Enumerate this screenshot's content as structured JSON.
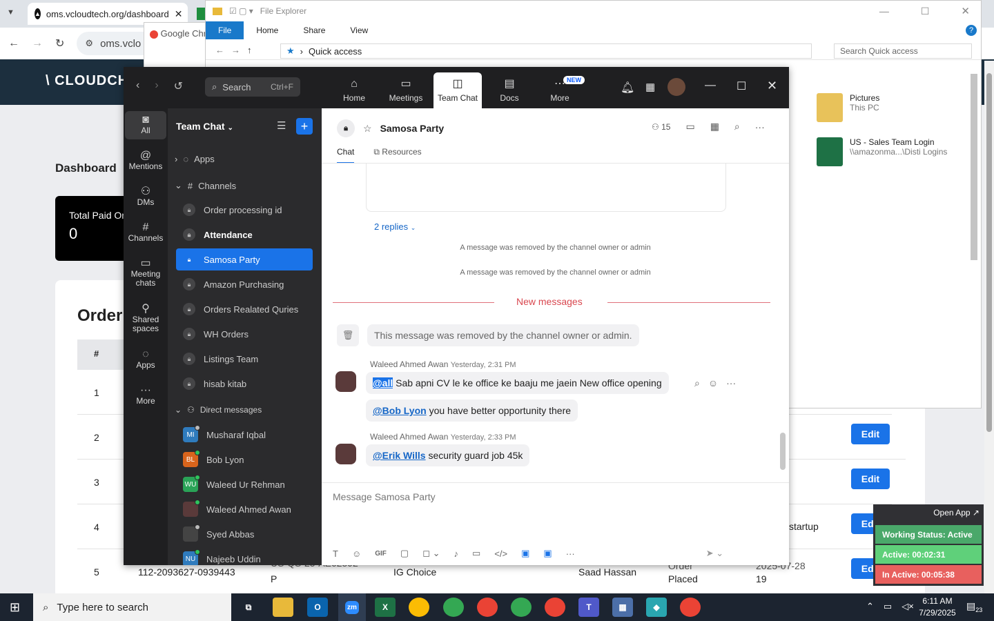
{
  "chrome": {
    "tab_title": "oms.vcloudtech.org/dashboard",
    "url": "oms.vclo",
    "popup_title": "Google Chr"
  },
  "site": {
    "logo": "\\ CLOUDCH",
    "dashboard_title": "Dashboard",
    "paid_card_label": "Total Paid Or",
    "paid_card_value": "0",
    "orders_title": "Order",
    "orders_header_num": "#",
    "row_numbers": [
      "1",
      "2",
      "3",
      "4",
      "5"
    ],
    "edit_label": "Edit",
    "row5": {
      "order_id": "112-2093627-0939443",
      "sku": "US-QS-25-AE62592",
      "sku_suffix": "P",
      "company": "IG Choice",
      "agent": "Saad Hassan",
      "status": "Order",
      "status2": "Placed",
      "date": "2025-07-28",
      "date2": "19"
    },
    "row4_note": "startup"
  },
  "explorer": {
    "title": "File Explorer",
    "ribbon": [
      "File",
      "Home",
      "Share",
      "View"
    ],
    "path": "Quick access",
    "search_placeholder": "Search Quick access",
    "items": [
      {
        "name": "Pictures",
        "sub": "This PC"
      },
      {
        "name": "US - Sales Team Login",
        "sub": "\\\\amazonma...\\Disti Logins"
      }
    ]
  },
  "zoom": {
    "search_label": "Search",
    "search_shortcut": "Ctrl+F",
    "tabs": [
      {
        "label": "Home",
        "icon": "⌂"
      },
      {
        "label": "Meetings",
        "icon": "▭"
      },
      {
        "label": "Team Chat",
        "icon": "◫"
      },
      {
        "label": "Docs",
        "icon": "▤"
      },
      {
        "label": "More",
        "icon": "⋯"
      }
    ],
    "new_badge": "NEW",
    "rail": [
      {
        "label": "All",
        "icon": "◙"
      },
      {
        "label": "Mentions",
        "icon": "@"
      },
      {
        "label": "DMs",
        "icon": "⚇"
      },
      {
        "label": "Channels",
        "icon": "#"
      },
      {
        "label": "Meeting chats",
        "icon": "▭"
      },
      {
        "label": "Shared spaces",
        "icon": "⚲"
      },
      {
        "label": "Apps",
        "icon": "◌"
      },
      {
        "label": "More",
        "icon": "···"
      }
    ],
    "sidebar": {
      "title": "Team Chat",
      "apps_label": "Apps",
      "channels_label": "Channels",
      "channels": [
        "Order processing id",
        "Attendance",
        "Samosa Party",
        "Amazon Purchasing",
        "Orders Realated Quries",
        "WH Orders",
        "Listings Team",
        "hisab kitab"
      ],
      "dm_label": "Direct messages",
      "dms": [
        {
          "name": "Musharaf Iqbal",
          "initials": "MI",
          "color": "#2f7bbd"
        },
        {
          "name": "Bob Lyon",
          "initials": "BL",
          "color": "#d8641c"
        },
        {
          "name": "Waleed Ur Rehman",
          "initials": "WU",
          "color": "#2aa357"
        },
        {
          "name": "Waleed Ahmed Awan",
          "initials": "",
          "color": "#5a3a3a"
        },
        {
          "name": "Syed Abbas",
          "initials": "",
          "color": "#444444"
        },
        {
          "name": "Najeeb Uddin",
          "initials": "NU",
          "color": "#2f7bbd"
        }
      ]
    },
    "channel": {
      "name": "Samosa Party",
      "member_count": "15",
      "tabs": [
        "Chat",
        "Resources"
      ],
      "replies": "2 replies",
      "removed_small": "A message was removed by the channel owner or admin",
      "new_messages": "New messages",
      "removed_big": "This message was removed by the channel owner or admin.",
      "msg1_sender": "Waleed Ahmed Awan",
      "msg1_time": "Yesterday, 2:31 PM",
      "msg1_mention": "@all",
      "msg1_text": " Sab apni CV le ke office ke baaju me jaein New office opening",
      "msg2_mention": "@Bob Lyon",
      "msg2_text": " you have better opportunity there",
      "msg3_sender": "Waleed Ahmed Awan",
      "msg3_time": "Yesterday, 2:33 PM",
      "msg3_mention": "@Erik Wills",
      "msg3_text": " security guard job 45k",
      "composer_placeholder": "Message Samosa Party"
    }
  },
  "status_widget": {
    "open_app": "Open App ↗",
    "working": "Working Status: Active",
    "active": "Active: 00:02:31",
    "inactive": "In Active: 00:05:38",
    "colors": {
      "working": "#4aa86a",
      "active": "#5fd07a",
      "inactive": "#e8605e"
    }
  },
  "taskbar": {
    "search_placeholder": "Type here to search",
    "time": "6:11 AM",
    "date": "7/29/2025",
    "notif_count": "23"
  }
}
